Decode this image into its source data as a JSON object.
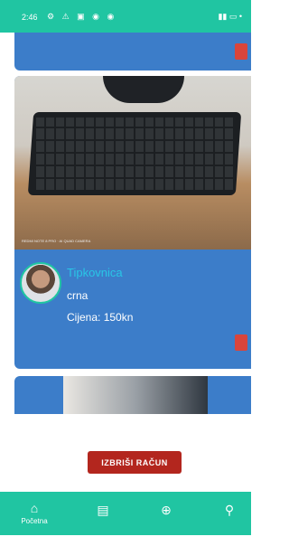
{
  "status_bar": {
    "time": "2:46",
    "icons": "⚙ ⚠ ▣ ◉ ◉",
    "right": "▮▮ ▭ •"
  },
  "listing": {
    "title": "Tipkovnica",
    "color": "crna",
    "price": "Cijena: 150kn",
    "watermark": "REDMI NOTE 8 PRO · AI QUAD CAMERA"
  },
  "actions": {
    "delete_account": "IZBRIŠI RAČUN"
  },
  "bottom_nav": {
    "home_label": "Početna",
    "home_icon": "⌂",
    "messages_icon": "▤",
    "add_icon": "⊕",
    "search_icon": "⚲"
  },
  "colors": {
    "accent": "#20c5a2",
    "card": "#3c7dc9",
    "danger": "#b3261e",
    "title": "#29c6e6"
  }
}
